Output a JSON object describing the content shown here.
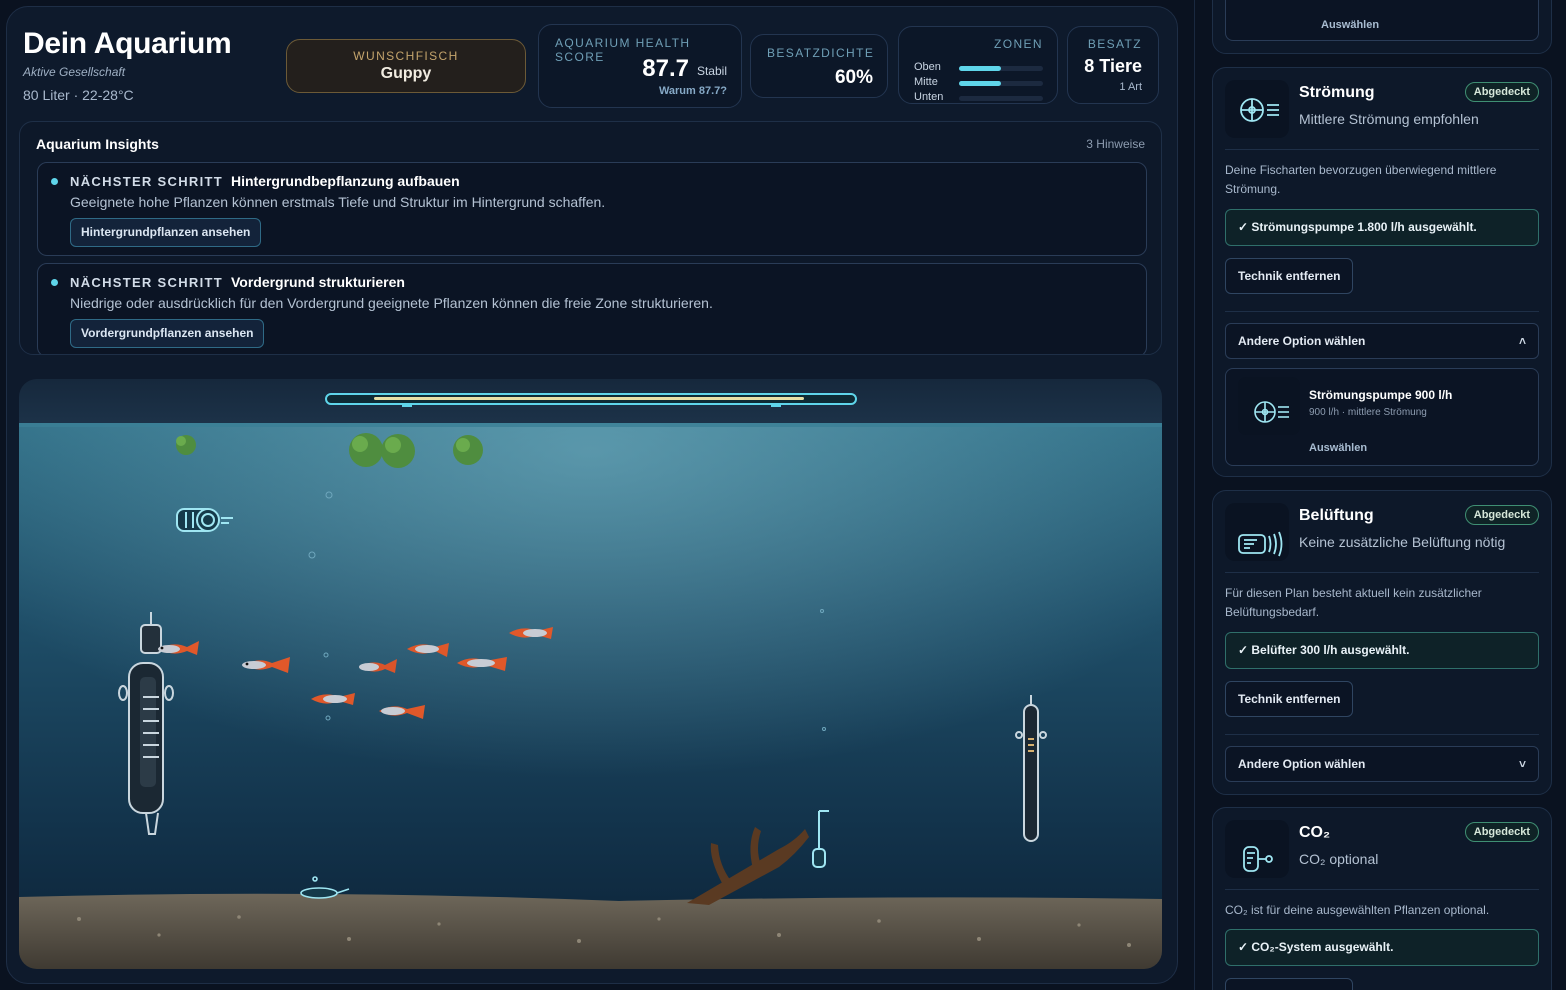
{
  "header": {
    "title": "Dein Aquarium",
    "subtitle": "Aktive Gesellschaft",
    "volume": "80 Liter · 22-28°C"
  },
  "wish": {
    "label": "Wunschfisch",
    "value": "Guppy"
  },
  "health": {
    "label": "Aquarium Health Score",
    "score": "87.7",
    "status": "Stabil",
    "why": "Warum 87.7?"
  },
  "density": {
    "label": "Besatzdichte",
    "value": "60%"
  },
  "zones": {
    "label": "Zonen",
    "rows": [
      {
        "name": "Oben",
        "fill": 0.5
      },
      {
        "name": "Mitte",
        "fill": 0.5
      },
      {
        "name": "Unten",
        "fill": 0.0
      }
    ]
  },
  "besatz": {
    "label": "Besatz",
    "value": "8 Tiere",
    "sub": "1 Art"
  },
  "insights": {
    "title": "Aquarium Insights",
    "count": "3 Hinweise",
    "items": [
      {
        "kicker": "Nächster Schritt",
        "head": "Hintergrundbepflanzung aufbauen",
        "desc": "Geeignete hohe Pflanzen können erstmals Tiefe und Struktur im Hintergrund schaffen.",
        "button": "Hintergrundpflanzen ansehen"
      },
      {
        "kicker": "Nächster Schritt",
        "head": "Vordergrund strukturieren",
        "desc": "Niedrige oder ausdrücklich für den Vordergrund geeignete Pflanzen können die freie Zone strukturieren.",
        "button": "Vordergrundpflanzen ansehen"
      }
    ]
  },
  "sidebar": {
    "top_partial": {
      "choose": "Auswählen"
    },
    "stroemung": {
      "title": "Strömung",
      "badge": "Abgedeckt",
      "sub": "Mittlere Strömung empfohlen",
      "desc": "Deine Fischarten bevorzugen überwiegend mittlere Strömung.",
      "selected": "✓ Strömungspumpe 1.800 l/h ausgewählt.",
      "remove": "Technik entfernen",
      "other": "Andere Option wählen",
      "other_chev": "˄",
      "option": {
        "name": "Strömungspumpe 900 l/h",
        "sub": "900 l/h · mittlere Strömung",
        "choose": "Auswählen"
      }
    },
    "belueftung": {
      "title": "Belüftung",
      "badge": "Abgedeckt",
      "sub": "Keine zusätzliche Belüftung nötig",
      "desc": "Für diesen Plan besteht aktuell kein zusätzlicher Belüftungsbedarf.",
      "selected": "✓ Belüfter 300 l/h ausgewählt.",
      "remove": "Technik entfernen",
      "other": "Andere Option wählen",
      "other_chev": "˅"
    },
    "co2": {
      "title": "CO₂",
      "badge": "Abgedeckt",
      "sub": "CO₂ optional",
      "desc": "CO₂ ist für deine ausgewählten Pflanzen optional.",
      "selected": "✓ CO₂-System ausgewählt."
    }
  },
  "icons": {
    "pump": "pump-icon",
    "aerator": "aerator-icon",
    "co2": "co2-icon",
    "heater": "heater-icon",
    "filter": "filter-icon",
    "light": "light-bar-icon"
  },
  "colors": {
    "accent": "#5fd5ea",
    "badge": "#3f8f73",
    "wish_border": "#6c5a37",
    "background": "#0a1220"
  }
}
